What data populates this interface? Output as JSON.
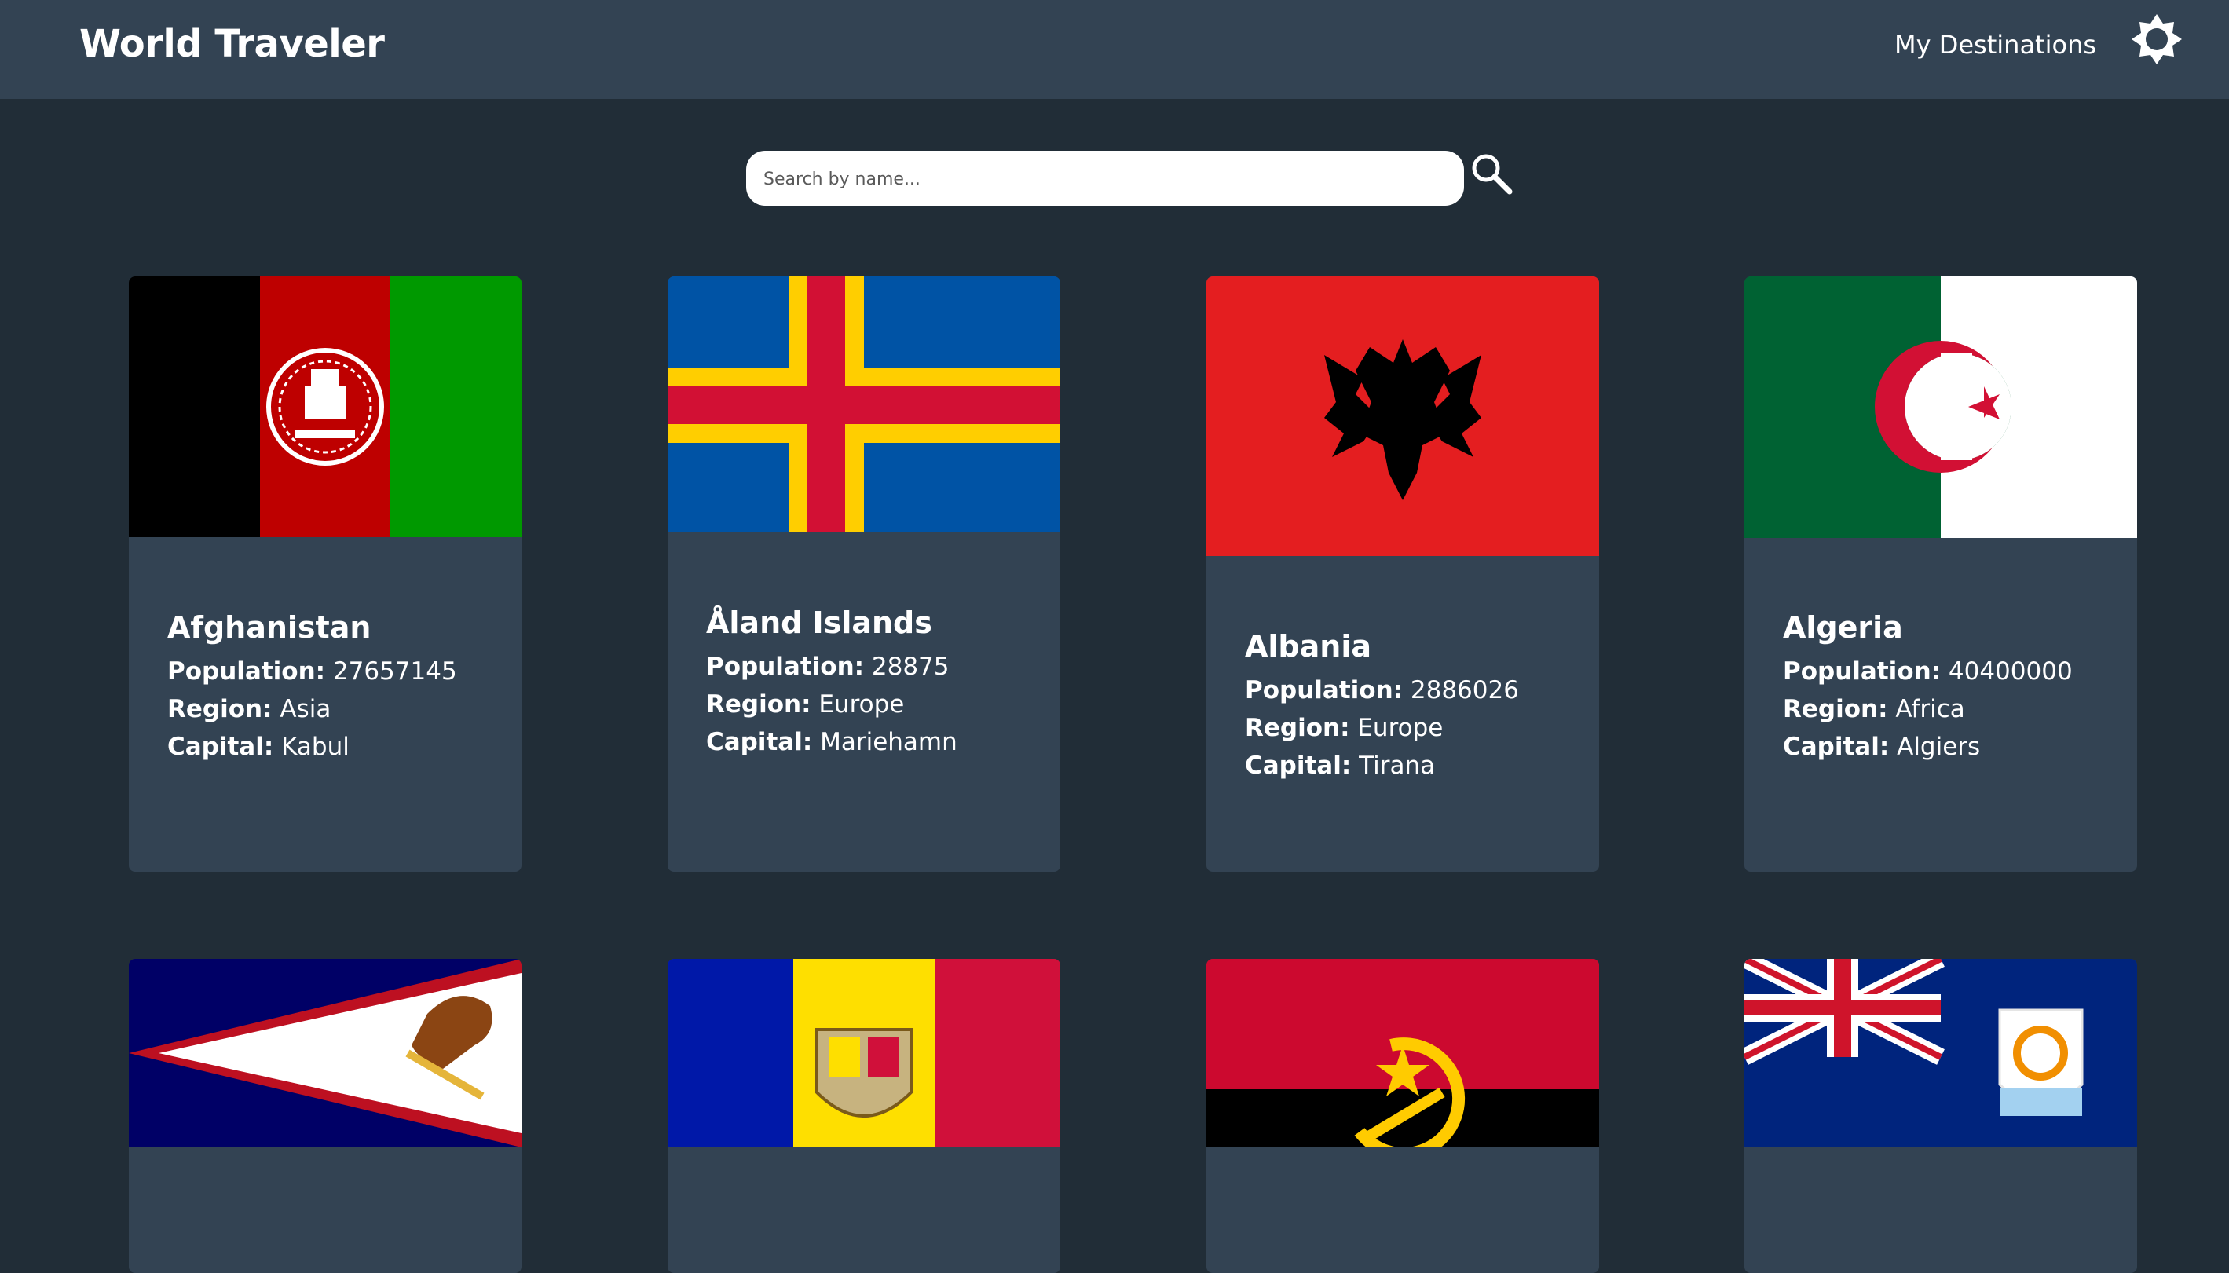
{
  "header": {
    "title": "World Traveler",
    "nav_link": "My Destinations",
    "theme_icon": "sun-icon"
  },
  "search": {
    "placeholder": "Search by name...",
    "button_icon": "search-icon"
  },
  "labels": {
    "population": "Population:",
    "region": "Region:",
    "capital": "Capital:"
  },
  "countries": [
    {
      "name": "Afghanistan",
      "population": "27657145",
      "region": "Asia",
      "capital": "Kabul"
    },
    {
      "name": "Åland Islands",
      "population": "28875",
      "region": "Europe",
      "capital": "Mariehamn"
    },
    {
      "name": "Albania",
      "population": "2886026",
      "region": "Europe",
      "capital": "Tirana"
    },
    {
      "name": "Algeria",
      "population": "40400000",
      "region": "Africa",
      "capital": "Algiers"
    }
  ],
  "more_flags": [
    "American Samoa flag",
    "Andorra flag",
    "Angola flag",
    "Anguilla flag"
  ],
  "colors": {
    "background": "#212d37",
    "surface": "#334353",
    "text": "#ffffff"
  }
}
